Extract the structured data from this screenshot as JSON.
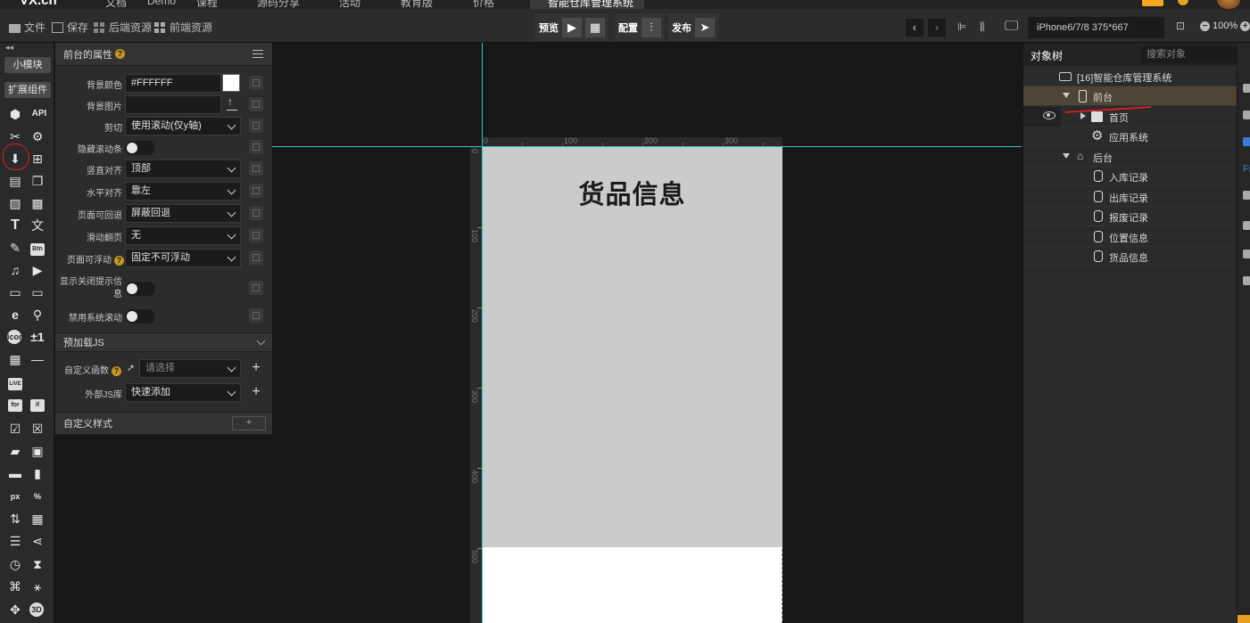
{
  "top_nav": {
    "logo": "VX.cn",
    "items": [
      "文档",
      "Demo",
      "课程",
      "源码分享",
      "活动",
      "教育版",
      "价格"
    ],
    "document_tab": "智能仓库管理系统"
  },
  "toolbar": {
    "file": "文件",
    "save": "保存",
    "backend_resources": "后端资源",
    "frontend_resources": "前端资源",
    "preview": "预览",
    "config": "配置",
    "publish": "发布",
    "device": "iPhone6/7/8 375*667",
    "zoom": "100%"
  },
  "iconbar": {
    "small_module": "小模块",
    "ext_components": "扩展组件",
    "api": "API",
    "btn": "Btn",
    "for": "for",
    "if": "if",
    "plus_minus": "±1",
    "px": "px",
    "percent": "%",
    "live": "LIVE",
    "icon": "icon",
    "three_d": "3D"
  },
  "props": {
    "title": "前台的属性",
    "rows": [
      {
        "label": "背景颜色",
        "value": "#FFFFFF"
      },
      {
        "label": "背景图片",
        "value": ""
      },
      {
        "label": "剪切",
        "value": "使用滚动(仅y轴)"
      },
      {
        "label": "隐藏滚动条",
        "value": ""
      },
      {
        "label": "竖直对齐",
        "value": "顶部"
      },
      {
        "label": "水平对齐",
        "value": "靠左"
      },
      {
        "label": "页面可回退",
        "value": "屏蔽回退"
      },
      {
        "label": "滑动翻页",
        "value": "无"
      },
      {
        "label": "页面可浮动",
        "value": "固定不可浮动"
      },
      {
        "label": "显示关闭提示信息",
        "value": ""
      },
      {
        "label": "禁用系统滚动",
        "value": ""
      }
    ],
    "preload_js": {
      "title": "预加载JS",
      "custom_func_label": "自定义函数",
      "custom_func_placeholder": "请选择",
      "external_lib_label": "外部JS库",
      "external_lib_value": "快速添加"
    },
    "custom_style": {
      "title": "自定义样式",
      "add": "+"
    }
  },
  "canvas": {
    "page_title": "货品信息",
    "ruler_h": [
      "0",
      "100",
      "200",
      "300"
    ],
    "ruler_v": [
      "0",
      "100",
      "200",
      "300",
      "400",
      "500"
    ]
  },
  "tree": {
    "tab": "对象树",
    "search_placeholder": "搜索对象",
    "items": [
      {
        "label": "[16]智能仓库管理系统"
      },
      {
        "label": "前台"
      },
      {
        "label": "首页"
      },
      {
        "label": "应用系统"
      },
      {
        "label": "后台"
      },
      {
        "label": "入库记录"
      },
      {
        "label": "出库记录"
      },
      {
        "label": "报废记录"
      },
      {
        "label": "位置信息"
      },
      {
        "label": "货品信息"
      }
    ]
  },
  "far_right": {
    "label": "Fi"
  },
  "colors": {
    "accent_red": "#e02020",
    "guide_cyan": "#37c0c8",
    "selected_row": "#4d4536",
    "page_gray": "#cbcbcb",
    "brand_orange": "#f5a623"
  }
}
